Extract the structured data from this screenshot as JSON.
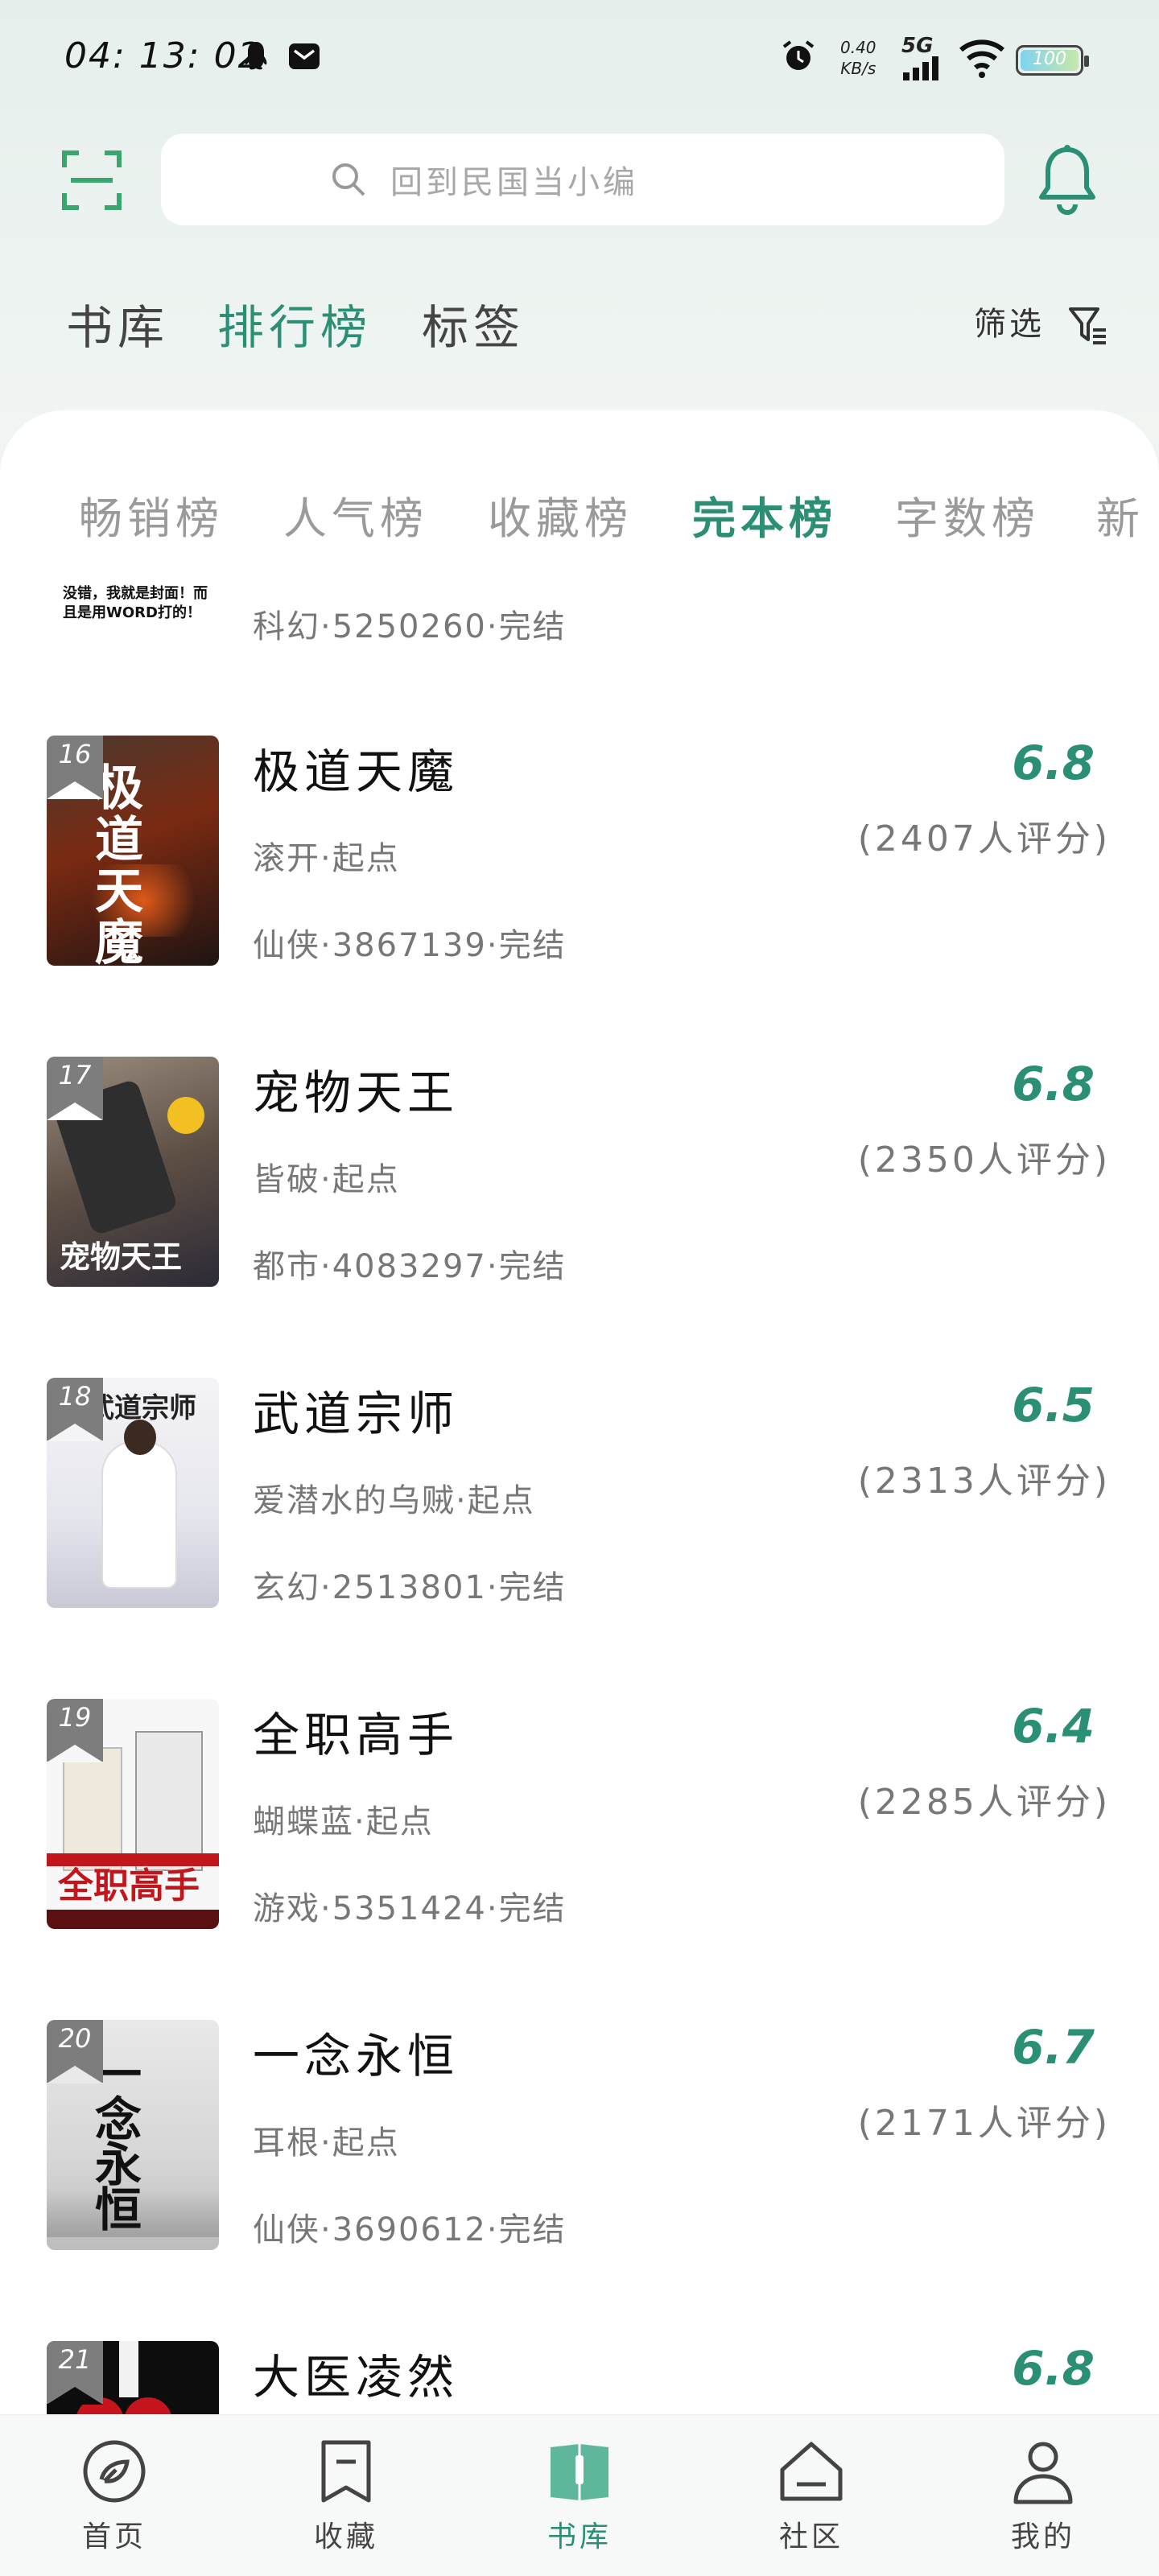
{
  "status_bar": {
    "time": "04: 13: 02",
    "speed_value": "0.40",
    "speed_unit": "KB/s",
    "network": "5G",
    "battery": "100"
  },
  "search": {
    "placeholder": "回到民国当小编"
  },
  "top_tabs": [
    {
      "label": "书库",
      "active": false
    },
    {
      "label": "排行榜",
      "active": true
    },
    {
      "label": "标签",
      "active": false
    }
  ],
  "filter_label": "筛选",
  "rank_tabs": [
    {
      "label": "畅销榜",
      "active": false
    },
    {
      "label": "人气榜",
      "active": false
    },
    {
      "label": "收藏榜",
      "active": false
    },
    {
      "label": "完本榜",
      "active": true
    },
    {
      "label": "字数榜",
      "active": false
    },
    {
      "label": "新",
      "active": false
    }
  ],
  "partial_book": {
    "cover_text": "没错，我就是封面！而且是用WORD打的！",
    "meta": "科幻·5250260·完结"
  },
  "books": [
    {
      "rank": "16",
      "title": "极道天魔",
      "author": "滚开·起点",
      "meta": "仙侠·3867139·完结",
      "score": "6.8",
      "raters": "(2407人评分)",
      "cover_text": "极道天魔"
    },
    {
      "rank": "17",
      "title": "宠物天王",
      "author": "皆破·起点",
      "meta": "都市·4083297·完结",
      "score": "6.8",
      "raters": "(2350人评分)",
      "cover_text": "宠物天王"
    },
    {
      "rank": "18",
      "title": "武道宗师",
      "author": "爱潜水的乌贼·起点",
      "meta": "玄幻·2513801·完结",
      "score": "6.5",
      "raters": "(2313人评分)",
      "cover_text": "武道宗师"
    },
    {
      "rank": "19",
      "title": "全职高手",
      "author": "蝴蝶蓝·起点",
      "meta": "游戏·5351424·完结",
      "score": "6.4",
      "raters": "(2285人评分)",
      "cover_text": "全职高手"
    },
    {
      "rank": "20",
      "title": "一念永恒",
      "author": "耳根·起点",
      "meta": "仙侠·3690612·完结",
      "score": "6.7",
      "raters": "(2171人评分)",
      "cover_text": "一念永恒"
    },
    {
      "rank": "21",
      "title": "大医凌然",
      "author": "",
      "meta": "",
      "score": "6.8",
      "raters": "",
      "cover_text": ""
    }
  ],
  "bottom_nav": [
    {
      "label": "首页",
      "icon": "home-icon",
      "active": false
    },
    {
      "label": "收藏",
      "icon": "bookmark-icon",
      "active": false
    },
    {
      "label": "书库",
      "icon": "library-icon",
      "active": true
    },
    {
      "label": "社区",
      "icon": "community-icon",
      "active": false
    },
    {
      "label": "我的",
      "icon": "profile-icon",
      "active": false
    }
  ],
  "colors": {
    "accent": "#2a8f75",
    "highlight": "#f5d94a"
  }
}
